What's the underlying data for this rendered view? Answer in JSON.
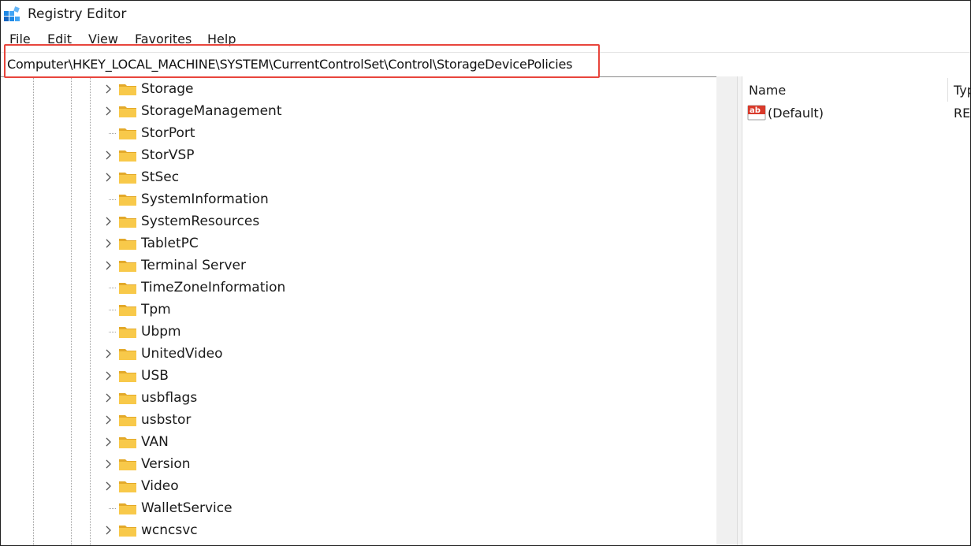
{
  "window": {
    "title": "Registry Editor"
  },
  "menu": [
    "File",
    "Edit",
    "View",
    "Favorites",
    "Help"
  ],
  "address": {
    "path": "Computer\\HKEY_LOCAL_MACHINE\\SYSTEM\\CurrentControlSet\\Control\\StorageDevicePolicies"
  },
  "tree": {
    "items": [
      {
        "label": "Storage",
        "expandable": true
      },
      {
        "label": "StorageManagement",
        "expandable": true
      },
      {
        "label": "StorPort",
        "expandable": false
      },
      {
        "label": "StorVSP",
        "expandable": true
      },
      {
        "label": "StSec",
        "expandable": true
      },
      {
        "label": "SystemInformation",
        "expandable": false
      },
      {
        "label": "SystemResources",
        "expandable": true
      },
      {
        "label": "TabletPC",
        "expandable": true
      },
      {
        "label": "Terminal Server",
        "expandable": true
      },
      {
        "label": "TimeZoneInformation",
        "expandable": false
      },
      {
        "label": "Tpm",
        "expandable": false
      },
      {
        "label": "Ubpm",
        "expandable": false
      },
      {
        "label": "UnitedVideo",
        "expandable": true
      },
      {
        "label": "USB",
        "expandable": true
      },
      {
        "label": "usbflags",
        "expandable": true
      },
      {
        "label": "usbstor",
        "expandable": true
      },
      {
        "label": "VAN",
        "expandable": true
      },
      {
        "label": "Version",
        "expandable": true
      },
      {
        "label": "Video",
        "expandable": true
      },
      {
        "label": "WalletService",
        "expandable": false
      },
      {
        "label": "wcncsvc",
        "expandable": true
      }
    ]
  },
  "values": {
    "columns": {
      "name": "Name",
      "type": "Typ"
    },
    "rows": [
      {
        "name": "(Default)",
        "type": "RE",
        "icon": "string-value-icon"
      }
    ]
  },
  "colors": {
    "highlight": "#e8453c",
    "folder": "#f8c94a",
    "folder_dark": "#e3a92a",
    "accent": "#0078d4"
  }
}
